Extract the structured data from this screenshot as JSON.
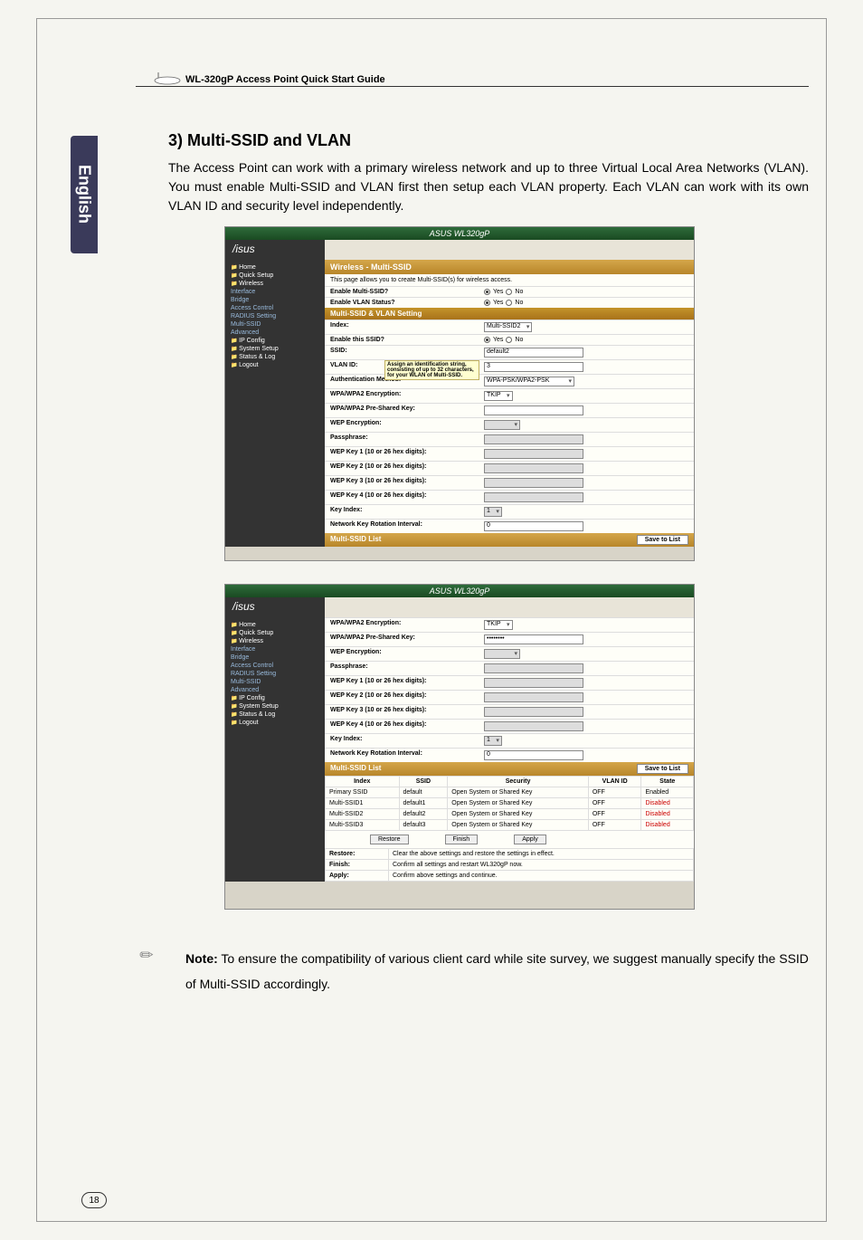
{
  "header": {
    "title": "WL-320gP Access Point Quick Start Guide"
  },
  "lang_tab": "English",
  "section_title": "3) Multi-SSID and VLAN",
  "intro": "The Access Point can work with a primary wireless network and up to three Virtual Local Area Networks (VLAN). You must enable Multi-SSID and VLAN first then setup each VLAN property. Each VLAN can work with its own VLAN ID and security level independently.",
  "screenshot1": {
    "device_title": "ASUS WL320gP",
    "logo": "/isus",
    "sidebar": {
      "home": "Home",
      "quick": "Quick Setup",
      "wireless": "Wireless",
      "interface": "Interface",
      "bridge": "Bridge",
      "access": "Access Control",
      "radius": "RADIUS Setting",
      "multi": "Multi-SSID",
      "advanced": "Advanced",
      "ipconfig": "IP Config",
      "system": "System Setup",
      "status": "Status & Log",
      "logout": "Logout"
    },
    "title_bar": "Wireless - Multi-SSID",
    "subtitle": "This page allows you to create Multi-SSID(s) for wireless access.",
    "rows": {
      "enable_multi": "Enable Multi-SSID?",
      "enable_vlan": "Enable VLAN Status?",
      "yes": "Yes",
      "no": "No",
      "vlan_header": "Multi-SSID & VLAN Setting",
      "index": "Index:",
      "index_val": "Multi-SSID2",
      "enable_this": "Enable this SSID?",
      "ssid": "SSID:",
      "ssid_val": "default2",
      "vlan_id": "VLAN ID:",
      "vlan_id_val": "3",
      "tooltip": "Assign an identification string, consisting of up to 32 characters, for your WLAN of Multi-SSID.",
      "auth": "Authentication Method:",
      "auth_val": "WPA-PSK/WPA2-PSK",
      "wpa_enc": "WPA/WPA2 Encryption:",
      "wpa_enc_val": "TKIP",
      "wpa_psk": "WPA/WPA2 Pre-Shared Key:",
      "wep_enc": "WEP Encryption:",
      "passphrase": "Passphrase:",
      "wep1": "WEP Key 1 (10 or 26 hex digits):",
      "wep2": "WEP Key 2 (10 or 26 hex digits):",
      "wep3": "WEP Key 3 (10 or 26 hex digits):",
      "wep4": "WEP Key 4 (10 or 26 hex digits):",
      "key_index": "Key Index:",
      "key_index_val": "1",
      "rotation": "Network Key Rotation Interval:",
      "rotation_val": "0",
      "list_title": "Multi-SSID List",
      "save_btn": "Save to List"
    }
  },
  "screenshot2": {
    "device_title": "ASUS WL320gP",
    "rows": {
      "wpa_enc": "WPA/WPA2 Encryption:",
      "wpa_enc_val": "TKIP",
      "wpa_psk": "WPA/WPA2 Pre-Shared Key:",
      "wpa_psk_val": "••••••••",
      "wep_enc": "WEP Encryption:",
      "passphrase": "Passphrase:",
      "wep1": "WEP Key 1 (10 or 26 hex digits):",
      "wep2": "WEP Key 2 (10 or 26 hex digits):",
      "wep3": "WEP Key 3 (10 or 26 hex digits):",
      "wep4": "WEP Key 4 (10 or 26 hex digits):",
      "key_index": "Key Index:",
      "key_index_val": "1",
      "rotation": "Network Key Rotation Interval:",
      "rotation_val": "0"
    },
    "list_header": "Multi-SSID List",
    "save_btn": "Save to List",
    "table": {
      "headers": {
        "index": "Index",
        "ssid": "SSID",
        "security": "Security",
        "vlan": "VLAN ID",
        "state": "State"
      },
      "rows": [
        {
          "index": "Primary SSID",
          "ssid": "default",
          "security": "Open System or Shared Key",
          "vlan": "OFF",
          "state": "Enabled"
        },
        {
          "index": "Multi-SSID1",
          "ssid": "default1",
          "security": "Open System or Shared Key",
          "vlan": "OFF",
          "state": "Disabled"
        },
        {
          "index": "Multi-SSID2",
          "ssid": "default2",
          "security": "Open System or Shared Key",
          "vlan": "OFF",
          "state": "Disabled"
        },
        {
          "index": "Multi-SSID3",
          "ssid": "default3",
          "security": "Open System or Shared Key",
          "vlan": "OFF",
          "state": "Disabled"
        }
      ]
    },
    "buttons": {
      "restore": "Restore",
      "finish": "Finish",
      "apply": "Apply"
    },
    "actions": {
      "restore_label": "Restore:",
      "restore_desc": "Clear the above settings and restore the settings in effect.",
      "finish_label": "Finish:",
      "finish_desc": "Confirm all settings and restart WL320gP now.",
      "apply_label": "Apply:",
      "apply_desc": "Confirm above settings and continue."
    }
  },
  "note": {
    "label": "Note:",
    "text": " To ensure the compatibility of various client card while site survey, we suggest manually specify the SSID of Multi-SSID accordingly."
  },
  "page_number": "18"
}
